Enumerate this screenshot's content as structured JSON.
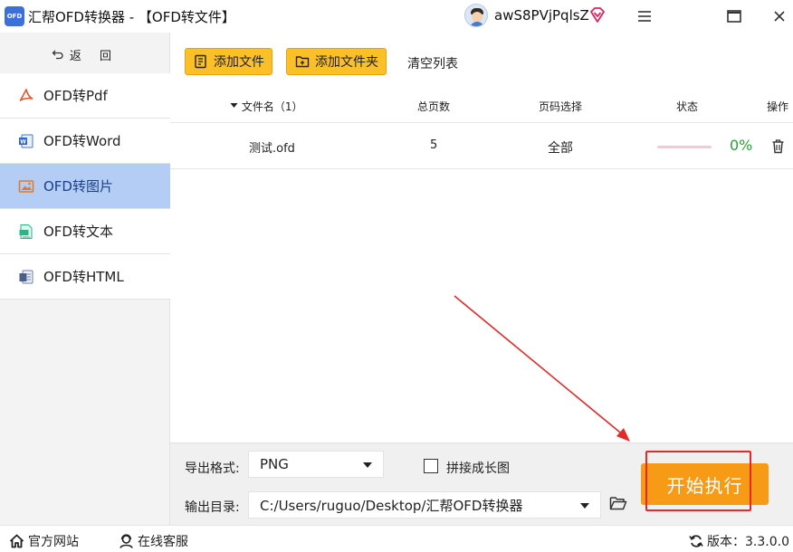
{
  "titlebar": {
    "logo_text": "OFD",
    "title": "汇帮OFD转换器 - 【OFD转文件】",
    "user_name": "awS8PVjPqlsZ"
  },
  "sidebar": {
    "back_label": "返 回",
    "items": [
      {
        "label": "OFD转Pdf",
        "icon": "pdf-icon"
      },
      {
        "label": "OFD转Word",
        "icon": "word-icon"
      },
      {
        "label": "OFD转图片",
        "icon": "image-icon",
        "active": true
      },
      {
        "label": "OFD转文本",
        "icon": "text-icon"
      },
      {
        "label": "OFD转HTML",
        "icon": "html-icon"
      }
    ]
  },
  "toolbar": {
    "add_file": "添加文件",
    "add_folder": "添加文件夹",
    "clear_list": "清空列表"
  },
  "table": {
    "headers": {
      "file_name": "文件名（1）",
      "pages": "总页数",
      "page_select": "页码选择",
      "status": "状态",
      "actions": "操作"
    },
    "rows": [
      {
        "file_name": "测试.ofd",
        "pages": "5",
        "page_select": "全部",
        "progress": 0,
        "percent": "0%"
      }
    ]
  },
  "settings": {
    "format_label": "导出格式:",
    "format_value": "PNG",
    "merge_label": "拼接成长图",
    "merge_checked": false,
    "output_label": "输出目录:",
    "output_value": "C:/Users/ruguo/Desktop/汇帮OFD转换器",
    "start_button": "开始执行"
  },
  "statusbar": {
    "website": "官方网站",
    "support": "在线客服",
    "version": "版本：3.3.0.0"
  },
  "colors": {
    "accent": "#fbbf27",
    "start": "#f79a16",
    "active_nav": "#b3cdf4",
    "annotation": "#e12a2a",
    "percent": "#27a337"
  }
}
